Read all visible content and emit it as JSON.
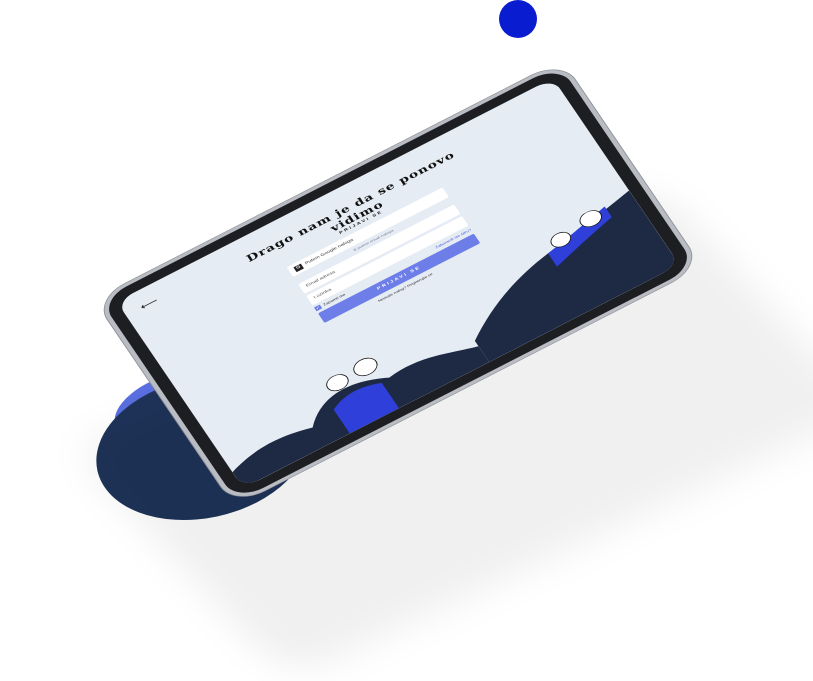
{
  "login": {
    "title": "Drago nam je da se ponovo vidimo",
    "subtitle": "PRIJAVI SE",
    "back_icon": "arrow-left-icon",
    "google_button": "Putem Google naloga",
    "email_note": "ili putem email naloga",
    "email_placeholder": "Email adresa",
    "password_placeholder": "Lozinka",
    "remember_label": "Zapamti me",
    "forgot_link": "Zaboravili ste šifru?",
    "submit_label": "PRIJAVI SE",
    "signup_text": "Nemate nalog?",
    "signup_link": "Registrujte se"
  },
  "colors": {
    "accent": "#6e7ee8",
    "navy": "#1e3358",
    "dot": "#0a1ccf",
    "screen_bg": "#e6ecf4"
  }
}
